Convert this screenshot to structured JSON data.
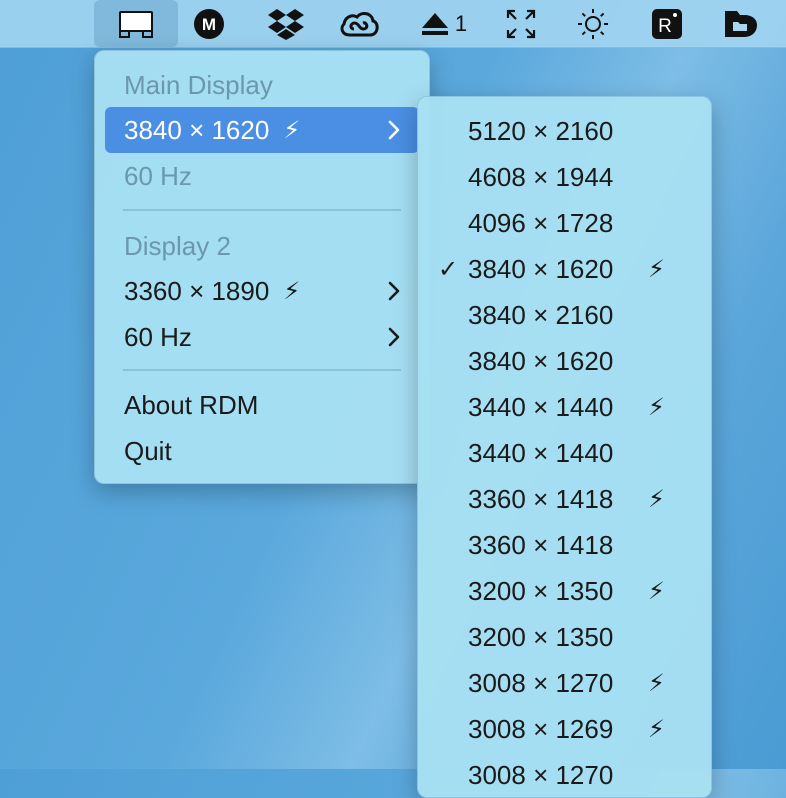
{
  "menubar": {
    "eject_count": "1",
    "icons": [
      "display-icon",
      "mega-icon",
      "dropbox-icon",
      "creative-cloud-icon",
      "eject-icon",
      "fullscreen-icon",
      "brightness-icon",
      "r-app-icon",
      "folder-app-icon"
    ]
  },
  "main_menu": {
    "main_display_header": "Main Display",
    "main_resolution": "3840 × 1620",
    "main_refresh": "60 Hz",
    "display2_header": "Display 2",
    "display2_resolution": "3360 × 1890",
    "display2_refresh": "60 Hz",
    "about": "About RDM",
    "quit": "Quit"
  },
  "bolt_glyph": "⚡",
  "check_glyph": "✓",
  "submenu": {
    "items": [
      {
        "label": "5120 × 2160",
        "hidpi": false,
        "checked": false
      },
      {
        "label": "4608 × 1944",
        "hidpi": false,
        "checked": false
      },
      {
        "label": "4096 × 1728",
        "hidpi": false,
        "checked": false
      },
      {
        "label": "3840 × 1620",
        "hidpi": true,
        "checked": true
      },
      {
        "label": "3840 × 2160",
        "hidpi": false,
        "checked": false
      },
      {
        "label": "3840 × 1620",
        "hidpi": false,
        "checked": false
      },
      {
        "label": "3440 × 1440",
        "hidpi": true,
        "checked": false
      },
      {
        "label": "3440 × 1440",
        "hidpi": false,
        "checked": false
      },
      {
        "label": "3360 × 1418",
        "hidpi": true,
        "checked": false
      },
      {
        "label": "3360 × 1418",
        "hidpi": false,
        "checked": false
      },
      {
        "label": "3200 × 1350",
        "hidpi": true,
        "checked": false
      },
      {
        "label": "3200 × 1350",
        "hidpi": false,
        "checked": false
      },
      {
        "label": "3008 × 1270",
        "hidpi": true,
        "checked": false
      },
      {
        "label": "3008 × 1269",
        "hidpi": true,
        "checked": false
      },
      {
        "label": "3008 × 1270",
        "hidpi": false,
        "checked": false
      }
    ]
  }
}
